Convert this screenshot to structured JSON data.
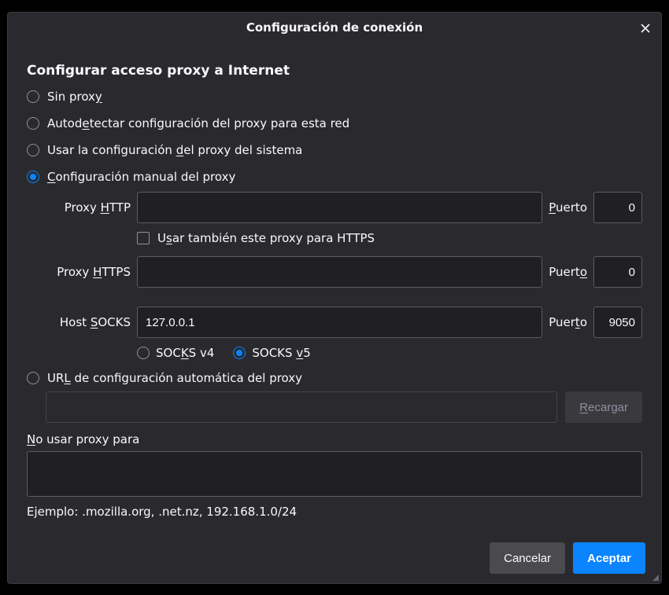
{
  "dialog": {
    "title": "Configuración de conexión",
    "heading": "Configurar acceso proxy a Internet",
    "radios": {
      "none_pre": "Sin prox",
      "none_u": "y",
      "none_post": "",
      "auto_pre": "Autod",
      "auto_u": "e",
      "auto_post": "tectar configuración del proxy para esta red",
      "system_pre": "Usar la configuración ",
      "system_u": "d",
      "system_post": "el proxy del sistema",
      "manual_pre": "",
      "manual_u": "C",
      "manual_post": "onfiguración manual del proxy",
      "url_pre": "UR",
      "url_u": "L",
      "url_post": " de configuración automática del proxy"
    },
    "http": {
      "label_pre": "Proxy ",
      "label_u": "H",
      "label_post": "TTP",
      "value": "",
      "port_pre": "",
      "port_u": "P",
      "port_post": "uerto",
      "port_value": "0"
    },
    "https_ck": {
      "pre": "U",
      "u": "s",
      "post": "ar también este proxy para HTTPS"
    },
    "https": {
      "label_pre": "Proxy ",
      "label_u": "H",
      "label_post": "TTPS",
      "value": "",
      "port_pre": "Puert",
      "port_u": "o",
      "port_post": "",
      "port_value": "0"
    },
    "socks": {
      "label_pre": "Host ",
      "label_u": "S",
      "label_post": "OCKS",
      "value": "127.0.0.1",
      "port_pre": "Puer",
      "port_u": "t",
      "port_post": "o",
      "port_value": "9050"
    },
    "socksv": {
      "v4_pre": "SOC",
      "v4_u": "K",
      "v4_post": "S v4",
      "v5_pre": "SOCKS ",
      "v5_u": "v",
      "v5_post": "5"
    },
    "url_field": {
      "value": ""
    },
    "reload_pre": "",
    "reload_u": "R",
    "reload_post": "ecargar",
    "noproxy_pre": "",
    "noproxy_u": "N",
    "noproxy_post": "o usar proxy para",
    "noproxy_value": "",
    "example": "Ejemplo: .mozilla.org, .net.nz, 192.168.1.0/24",
    "cancel": "Cancelar",
    "accept": "Aceptar"
  }
}
